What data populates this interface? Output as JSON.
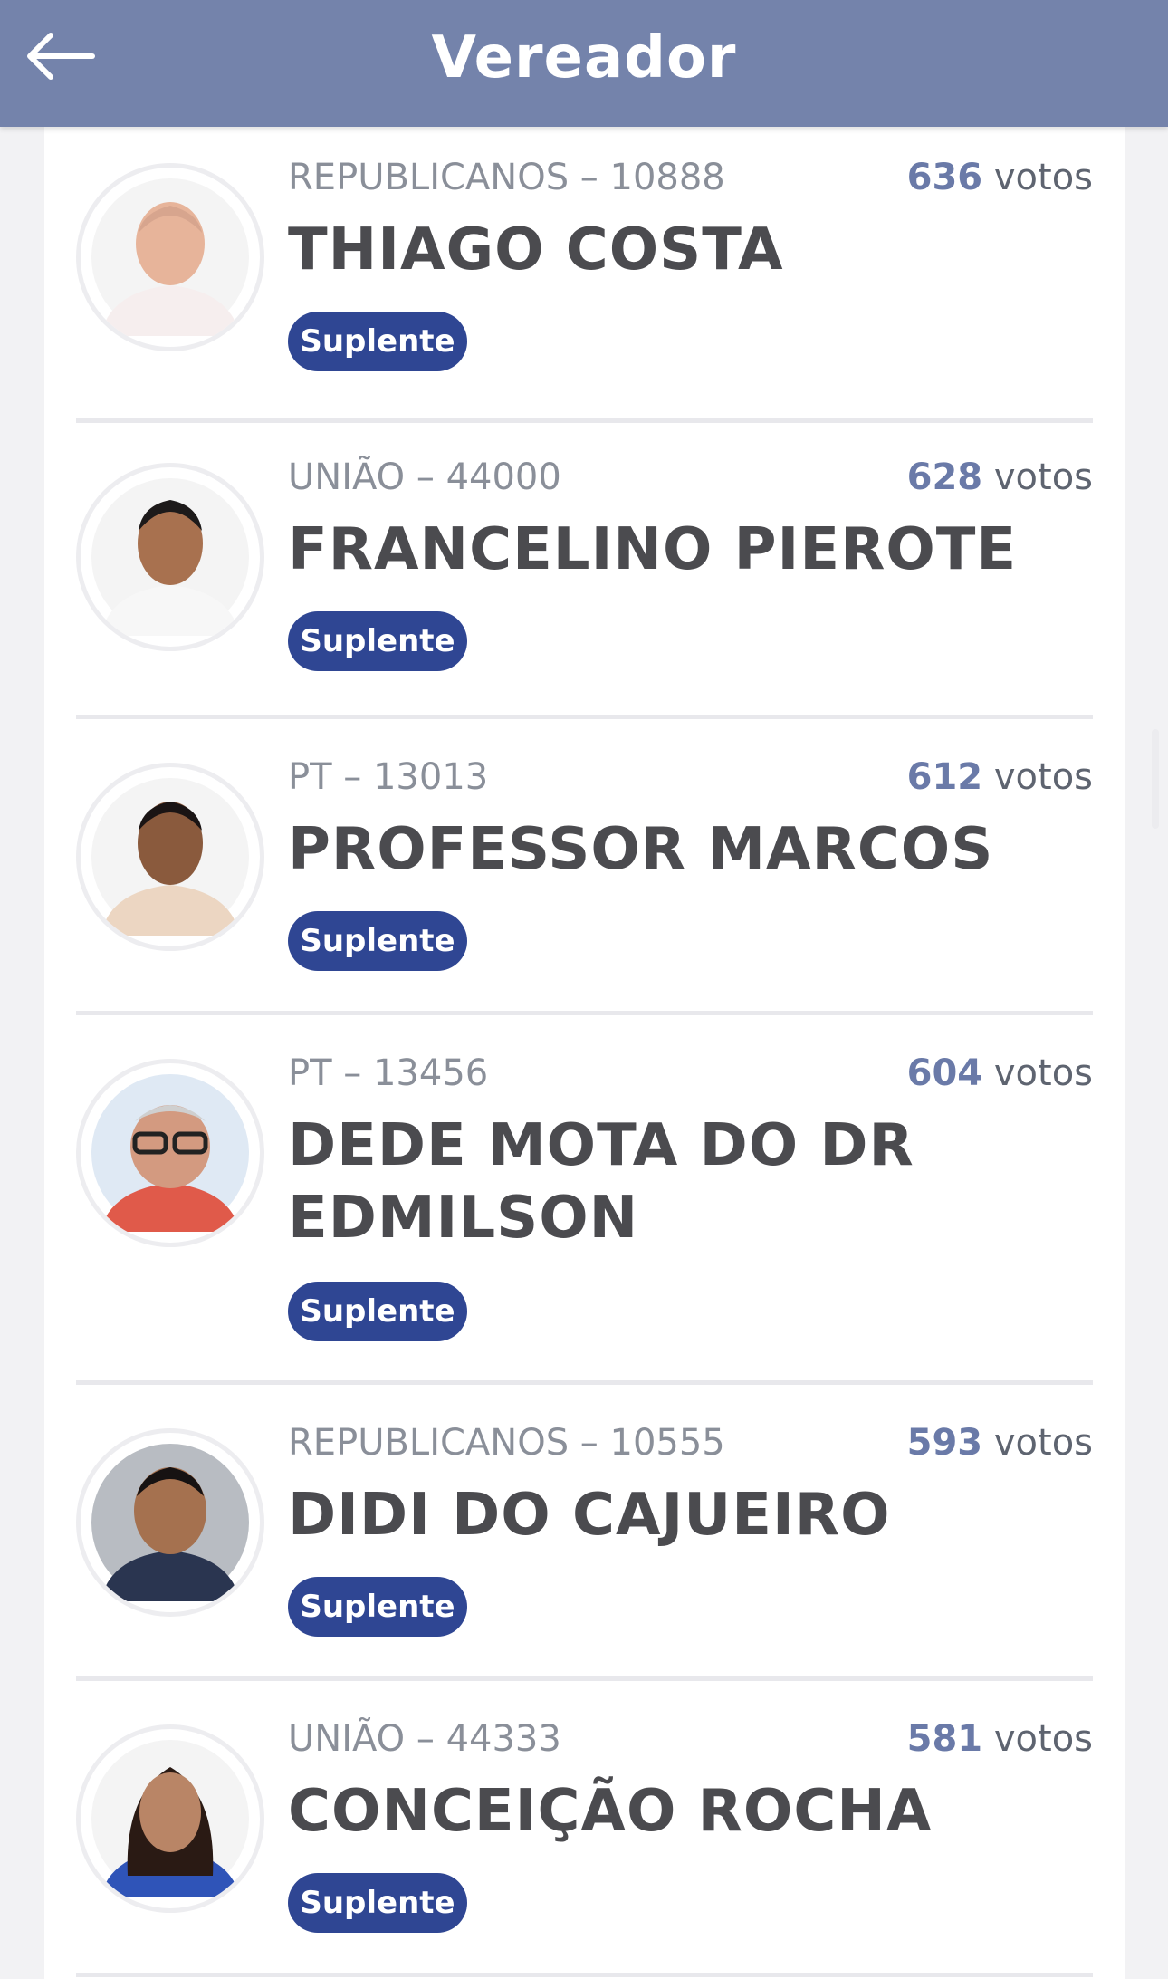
{
  "header": {
    "title": "Vereador",
    "back_icon": "arrow-left-icon"
  },
  "candidates": [
    {
      "party": "REPUBLICANOS – 10888",
      "name": "THIAGO COSTA",
      "votes_number": "636",
      "votes_label": "votos",
      "status": "Suplente"
    },
    {
      "party": "UNIÃO – 44000",
      "name": "FRANCELINO PIEROTE",
      "votes_number": "628",
      "votes_label": "votos",
      "status": "Suplente"
    },
    {
      "party": "PT – 13013",
      "name": "PROFESSOR MARCOS",
      "votes_number": "612",
      "votes_label": "votos",
      "status": "Suplente"
    },
    {
      "party": "PT – 13456",
      "name": "DEDE MOTA DO DR EDMILSON",
      "votes_number": "604",
      "votes_label": "votos",
      "status": "Suplente"
    },
    {
      "party": "REPUBLICANOS – 10555",
      "name": "DIDI DO CAJUEIRO",
      "votes_number": "593",
      "votes_label": "votos",
      "status": "Suplente"
    },
    {
      "party": "UNIÃO – 44333",
      "name": "CONCEIÇÃO ROCHA",
      "votes_number": "581",
      "votes_label": "votos",
      "status": "Suplente"
    }
  ],
  "colors": {
    "header_bg": "#7483ab",
    "badge_bg": "#2f4693",
    "votes_number": "#6a7aa8",
    "name_text": "#4b4b4f"
  }
}
